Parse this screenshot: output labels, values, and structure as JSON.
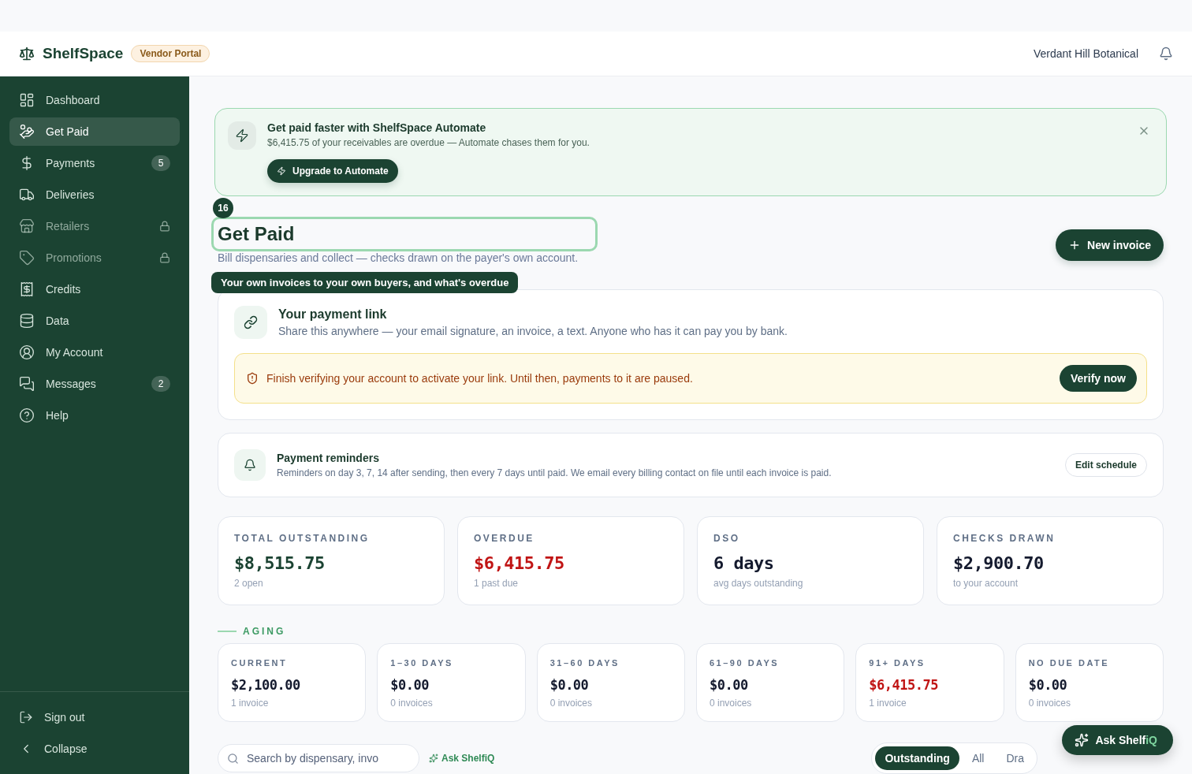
{
  "header": {
    "brand": "ShelfSpace",
    "badge": "Vendor Portal",
    "account": "Verdant Hill Botanical"
  },
  "sidebar": {
    "items": [
      {
        "label": "Dashboard",
        "selected": false,
        "locked": false
      },
      {
        "label": "Get Paid",
        "selected": true,
        "locked": false
      },
      {
        "label": "Payments",
        "selected": false,
        "locked": false,
        "count": "5"
      },
      {
        "label": "Deliveries",
        "selected": false,
        "locked": false
      },
      {
        "label": "Retailers",
        "selected": false,
        "locked": true
      },
      {
        "label": "Promotions",
        "selected": false,
        "locked": true
      },
      {
        "label": "Credits",
        "selected": false,
        "locked": false
      },
      {
        "label": "Data",
        "selected": false,
        "locked": false
      },
      {
        "label": "My Account",
        "selected": false,
        "locked": false
      },
      {
        "label": "Messages",
        "selected": false,
        "locked": false,
        "count": "2"
      },
      {
        "label": "Help",
        "selected": false,
        "locked": false
      }
    ],
    "footer": [
      {
        "label": "Sign out"
      },
      {
        "label": "Collapse"
      }
    ]
  },
  "promo": {
    "title": "Get paid faster with ShelfSpace Automate",
    "text": "$6,415.75 of your receivables are overdue — Automate chases them for you.",
    "button": "Upgrade to Automate"
  },
  "page": {
    "title": "Get Paid",
    "subtitle": "Bill dispensaries and collect — checks drawn on the payer's own account.",
    "button": "New invoice"
  },
  "tour": {
    "step": "16",
    "tip": "Your own invoices to your own buyers, and what's overdue"
  },
  "payment_link": {
    "title": "Your payment link",
    "text": "Share this anywhere — your email signature, an invoice, a text. Anyone who has it can pay you by bank.",
    "warning": "Finish verifying your account to activate your link. Until then, payments to it are paused.",
    "button": "Verify now"
  },
  "reminders": {
    "title": "Payment reminders",
    "text": "Reminders on day 3, 7, 14 after sending, then every 7 days until paid. We email every billing contact on file until each invoice is paid.",
    "button": "Edit schedule"
  },
  "stats": [
    {
      "label": "TOTAL OUTSTANDING",
      "value": "$8,515.75",
      "note": "2 open",
      "highlight": true,
      "overdue": false
    },
    {
      "label": "OVERDUE",
      "value": "$6,415.75",
      "note": "1 past due",
      "highlight": false,
      "overdue": true
    },
    {
      "label": "DSO",
      "value": "6 days",
      "note": "avg days outstanding",
      "highlight": false,
      "overdue": false
    },
    {
      "label": "CHECKS DRAWN",
      "value": "$2,900.70",
      "note": "to your account",
      "highlight": false,
      "overdue": false
    }
  ],
  "aging": {
    "label": "AGING",
    "buckets": [
      {
        "label": "CURRENT",
        "value": "$2,100.00",
        "note": "1 invoice",
        "overdue": false
      },
      {
        "label": "1–30 DAYS",
        "value": "$0.00",
        "note": "0 invoices",
        "overdue": false
      },
      {
        "label": "31–60 DAYS",
        "value": "$0.00",
        "note": "0 invoices",
        "overdue": false
      },
      {
        "label": "61–90 DAYS",
        "value": "$0.00",
        "note": "0 invoices",
        "overdue": false
      },
      {
        "label": "91+ DAYS",
        "value": "$6,415.75",
        "note": "1 invoice",
        "overdue": true
      },
      {
        "label": "NO DUE DATE",
        "value": "$0.00",
        "note": "0 invoices",
        "overdue": false
      }
    ]
  },
  "search": {
    "placeholder": "Search by dispensary, invo"
  },
  "ask_link": "Ask ShelfiQ",
  "filters": [
    {
      "label": "Outstanding",
      "selected": true
    },
    {
      "label": "All",
      "selected": false
    },
    {
      "label": "Dra",
      "selected": false
    }
  ],
  "assistant": {
    "label": "Ask Shelf",
    "accent": "iQ"
  }
}
